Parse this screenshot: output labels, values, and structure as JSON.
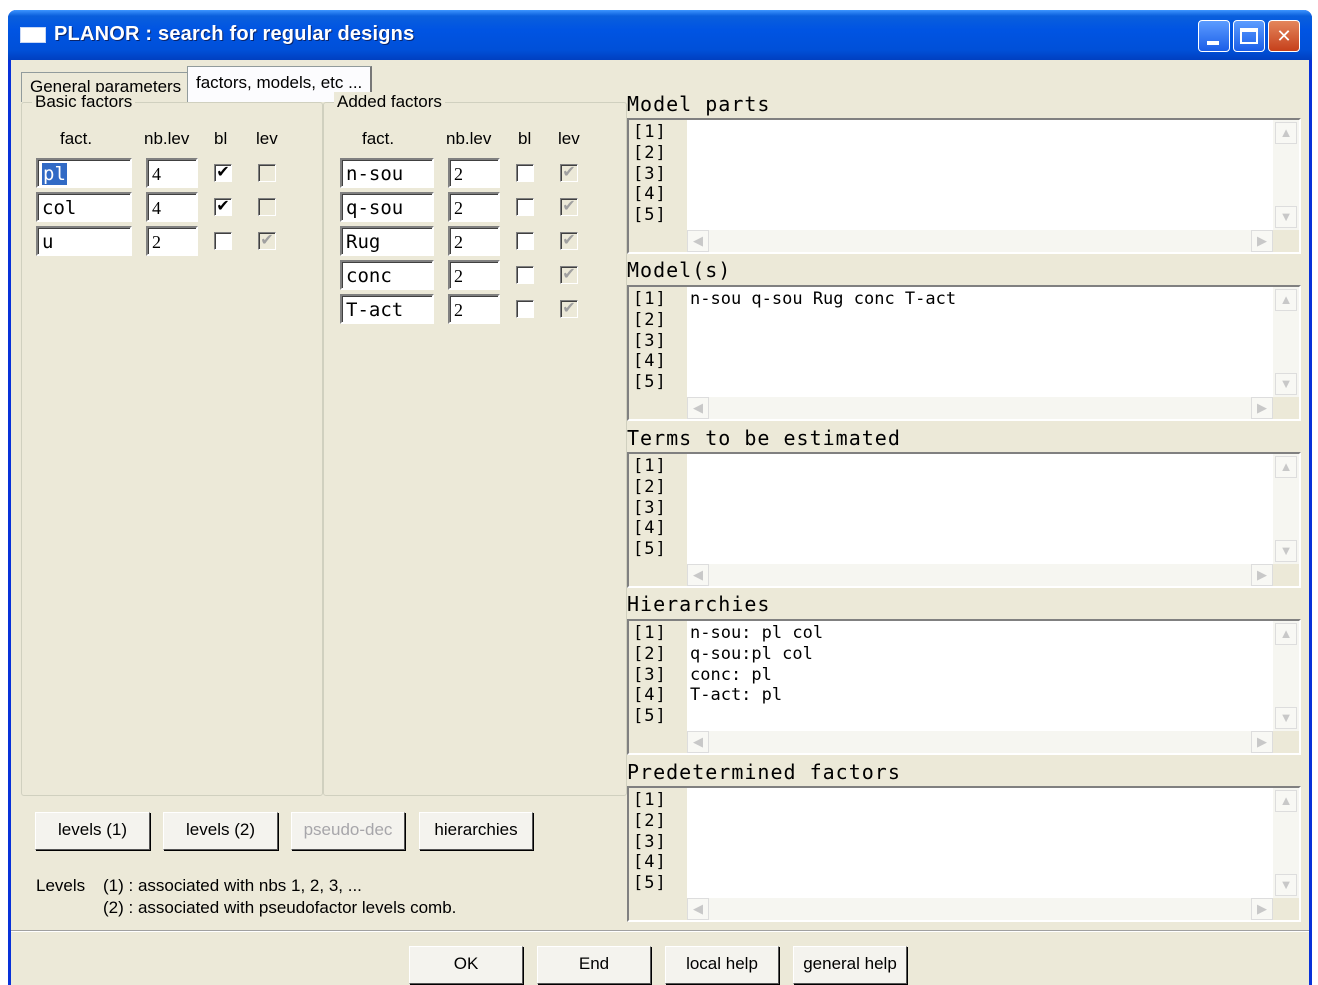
{
  "window": {
    "title": "PLANOR : search for regular designs"
  },
  "tabs": [
    {
      "label": "General parameters"
    },
    {
      "label": "factors, models, etc ..."
    }
  ],
  "basic_factors": {
    "legend": "Basic factors",
    "headers": {
      "fact": "fact.",
      "nblev": "nb.lev",
      "bl": "bl",
      "lev": "lev"
    },
    "rows": [
      {
        "fact": "pl",
        "nblev": "4",
        "bl": true,
        "lev": false
      },
      {
        "fact": "col",
        "nblev": "4",
        "bl": true,
        "lev": false
      },
      {
        "fact": "u",
        "nblev": "2",
        "bl": false,
        "lev": true
      }
    ]
  },
  "added_factors": {
    "legend": "Added factors",
    "headers": {
      "fact": "fact.",
      "nblev": "nb.lev",
      "bl": "bl",
      "lev": "lev"
    },
    "rows": [
      {
        "fact": "n-sou",
        "nblev": "2",
        "bl": false,
        "lev": true
      },
      {
        "fact": "q-sou",
        "nblev": "2",
        "bl": false,
        "lev": true
      },
      {
        "fact": "Rug",
        "nblev": "2",
        "bl": false,
        "lev": true
      },
      {
        "fact": "conc",
        "nblev": "2",
        "bl": false,
        "lev": true
      },
      {
        "fact": "T-act",
        "nblev": "2",
        "bl": false,
        "lev": true
      }
    ]
  },
  "sections": [
    {
      "title": "Model parts",
      "line_numbers": "[1]\n[2]\n[3]\n[4]\n[5]",
      "content": ""
    },
    {
      "title": "Model(s)",
      "line_numbers": "[1]\n[2]\n[3]\n[4]\n[5]",
      "content": "n-sou q-sou Rug conc T-act"
    },
    {
      "title": "Terms to be estimated",
      "line_numbers": "[1]\n[2]\n[3]\n[4]\n[5]",
      "content": ""
    },
    {
      "title": "Hierarchies",
      "line_numbers": "[1]\n[2]\n[3]\n[4]\n[5]",
      "content": "n-sou: pl col\nq-sou:pl col\nconc: pl\nT-act: pl"
    },
    {
      "title": "Predetermined factors",
      "line_numbers": "[1]\n[2]\n[3]\n[4]\n[5]",
      "content": ""
    }
  ],
  "panel_buttons": {
    "levels1": "levels (1)",
    "levels2": "levels (2)",
    "pseudo_dec": "pseudo-dec",
    "hierarchies": "hierarchies"
  },
  "levels_note": {
    "label": "Levels",
    "line1": "(1) : associated with nbs 1, 2, 3, ...",
    "line2": "(2) : associated with pseudofactor levels comb."
  },
  "footer_buttons": {
    "ok": "OK",
    "end": "End",
    "local_help": "local help",
    "general_help": "general help"
  }
}
